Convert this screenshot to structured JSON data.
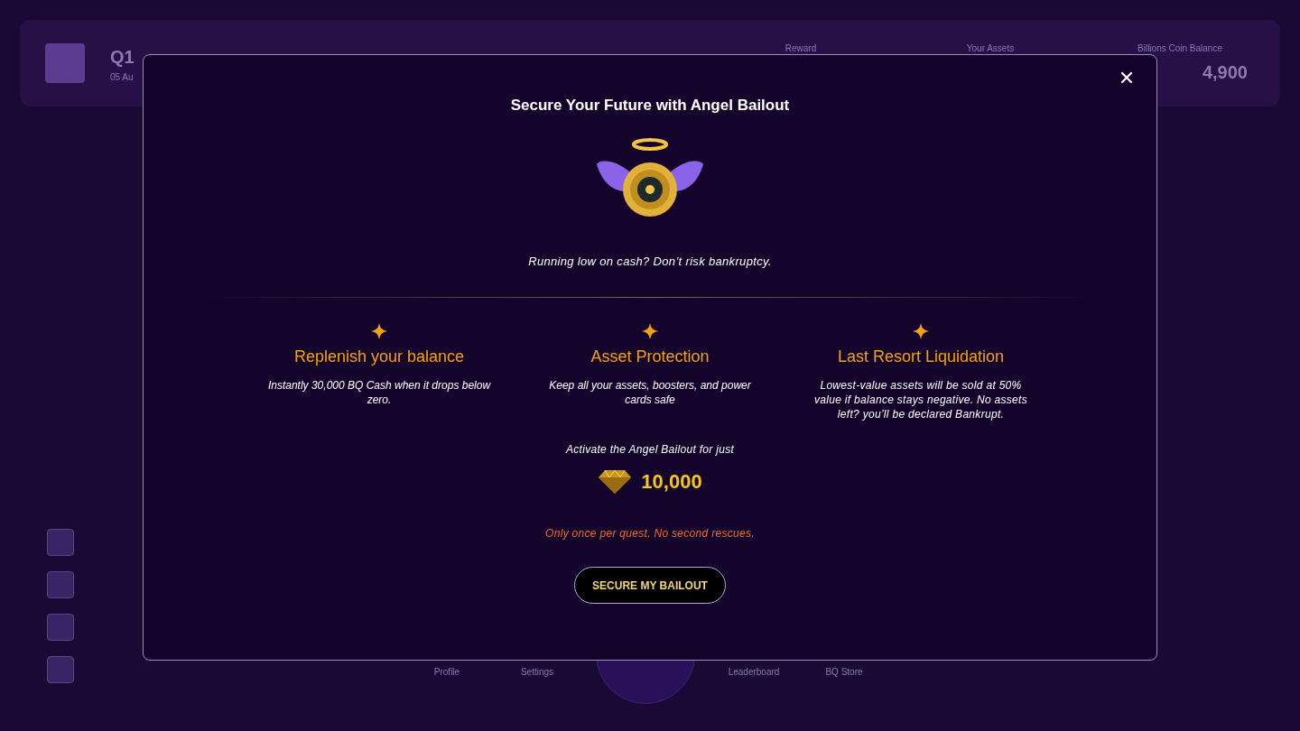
{
  "header": {
    "quest": "Q1",
    "date": "05 Au",
    "stats": [
      {
        "label": "Reward"
      },
      {
        "label": "Your Assets"
      },
      {
        "label": "Billions Coin Balance",
        "value": "4,900"
      }
    ]
  },
  "bottom_nav": [
    {
      "label": "Profile"
    },
    {
      "label": "Settings"
    },
    {
      "label": "Leaderboard"
    },
    {
      "label": "BQ Store"
    }
  ],
  "modal": {
    "title": "Secure Your Future with Angel Bailout",
    "subtitle": "Running low on cash? Don’t risk bankruptcy.",
    "features": [
      {
        "title": "Replenish your balance",
        "description": "Instantly 30,000 BQ Cash when it drops below zero."
      },
      {
        "title": "Asset Protection",
        "description": "Keep all your assets, boosters, and power cards safe"
      },
      {
        "title": "Last Resort Liquidation",
        "description": "Lowest-value assets will be sold at 50% value if balance stays negative. No assets left? you’ll be declared Bankrupt."
      }
    ],
    "price_label": "Activate the Angel Bailout for just",
    "price": "10,000",
    "note": "Only once per quest. No second rescues.",
    "button": "SECURE MY BAILOUT"
  }
}
